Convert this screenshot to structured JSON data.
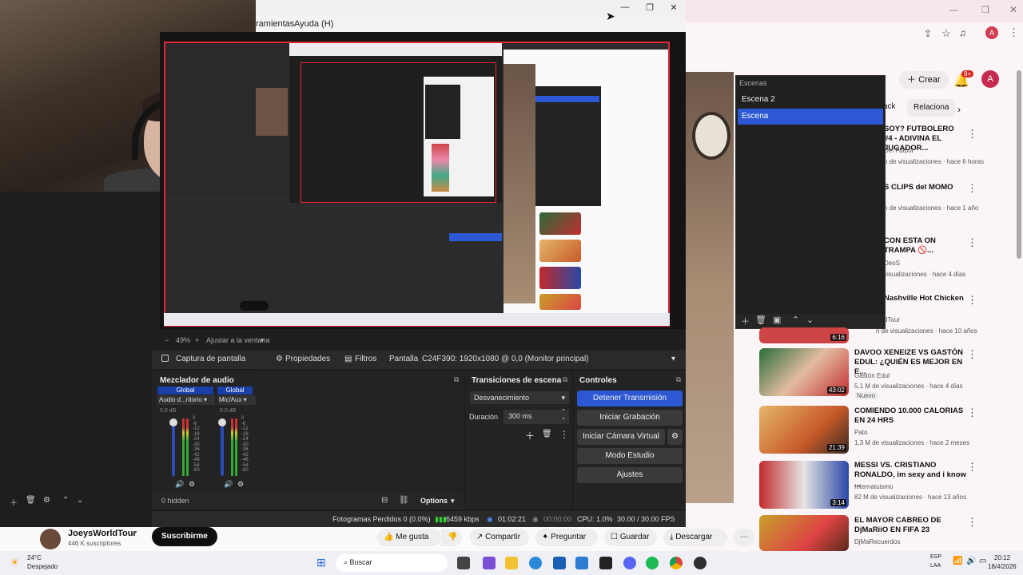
{
  "obs": {
    "menu": {
      "tools": "ramientas",
      "help": "Ayuda (H)"
    },
    "zoom": {
      "value": "49%",
      "fit": "Ajustar a la ventana"
    },
    "source": {
      "name": "Captura de pantalla",
      "properties": "Propiedades",
      "filters": "Filtros",
      "display_label": "Pantalla",
      "display_value": "C24F390: 1920x1080 @ 0,0 (Monitor principal)"
    },
    "mixer": {
      "title": "Mezclador de audio",
      "ch1": {
        "label": "Global",
        "name": "Audio d...ritorio",
        "db": "0.0 dB"
      },
      "ch2": {
        "label": "Global",
        "name": "Mic/Aux",
        "db": "0.0 dB"
      },
      "scale": [
        "0",
        "-6",
        "-12",
        "-18",
        "-24",
        "-30",
        "-36",
        "-42",
        "-48",
        "-54",
        "-60"
      ],
      "hidden": "0 hidden",
      "options": "Options"
    },
    "transitions": {
      "title": "Transiciones de escena",
      "type": "Desvanecimiento",
      "duration_label": "Duración",
      "duration_value": "300 ms"
    },
    "controls": {
      "title": "Controles",
      "stop_stream": "Detener Transmisión",
      "start_record": "Iniciar Grabación",
      "start_virtual": "Iniciar Cámara Virtual",
      "studio": "Modo Estudio",
      "settings": "Ajustes"
    },
    "status": {
      "dropped": "Fotogramas Perdidos 0 (0.0%)",
      "bitrate": "6459 kbps",
      "stream_time": "01:02:21",
      "rec_time": "00:00:00",
      "cpu": "CPU: 1.0%",
      "fps": "30.00 / 30.00 FPS"
    }
  },
  "scenes": {
    "title": "Escenas",
    "items": [
      "Escena 2",
      "Escena"
    ]
  },
  "youtube": {
    "create": "Crear",
    "notif": "9+",
    "avatar": "A",
    "chips": [
      "ack",
      "Relaciona"
    ],
    "channel": {
      "name": "JoeysWorldTour",
      "subs": "446 K suscriptores",
      "subscribe": "Suscribirme"
    },
    "actions": {
      "like": "Me gusta",
      "share": "Compartir",
      "ask": "Preguntar",
      "save": "Guardar",
      "download": "Descargar"
    },
    "partial": [
      {
        "title": "SOY? FUTBOLERO #4 - ADIVINA EL JUGADOR...",
        "meta1": "Del Fútbol",
        "meta2": "n de visualizaciones · hace 6 horas"
      },
      {
        "title": "S CLIPS del MOMO",
        "meta1": "",
        "meta2": "n de visualizaciones · hace 1 año"
      },
      {
        "title": "CON ESTA ON TRAMPA 🚫...",
        "meta1": "DeoS",
        "meta2": "visualizaciones · hace 4 días"
      },
      {
        "title": "Nashville Hot Chicken",
        "meta1": "dTour",
        "meta2": "n de visualizaciones · hace 10 años"
      }
    ],
    "videos": [
      {
        "title": "DAVOO XENEIZE VS GASTÓN EDUL: ¿QUIÉN ES MEJOR EN E...",
        "channel": "Gastón Edul",
        "meta": "5,1 M de visualizaciones · hace 4 días",
        "badge": "Nuevo",
        "duration": "43:02"
      },
      {
        "title": "COMIENDO 10.000 CALORIAS EN 24 HRS",
        "channel": "Pato",
        "meta": "1,3 M de visualizaciones · hace 2 meses",
        "badge": "",
        "duration": "21:39"
      },
      {
        "title": "MESSI VS. CRISTIANO RONALDO, im sexy and i know ...",
        "channel": "Internatuismo",
        "meta": "82 M de visualizaciones · hace 13 años",
        "badge": "",
        "duration": "3:14"
      },
      {
        "title": "EL MAYOR CABREO DE DjMaRiiO EN FIFA 23",
        "channel": "DjMaRecuerdos",
        "meta": "",
        "badge": "",
        "duration": ""
      }
    ],
    "top_duration": "6:16"
  },
  "taskbar": {
    "weather_temp": "24°C",
    "weather_desc": "Despejado",
    "search": "Buscar",
    "lang": "ESP",
    "lang2": "LAA",
    "time": "20:12",
    "date": "18/4/2026"
  }
}
